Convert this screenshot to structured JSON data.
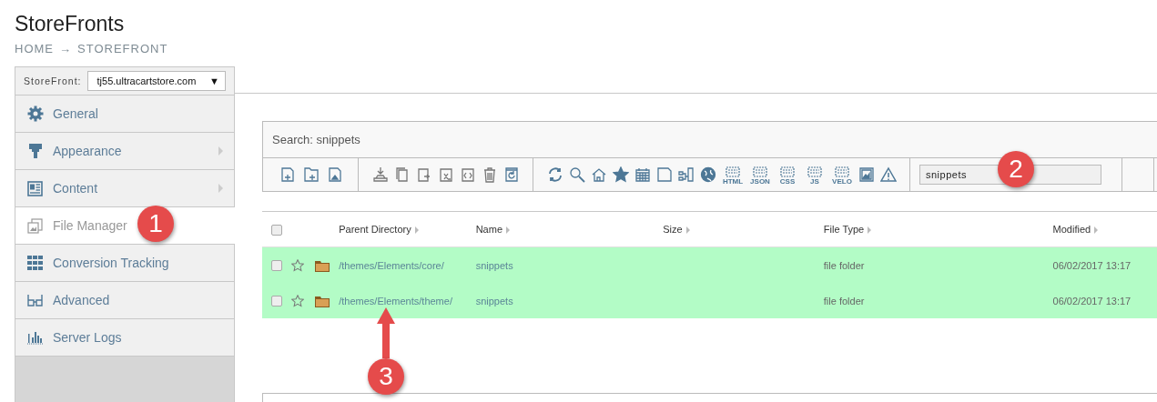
{
  "page": {
    "title": "StoreFronts",
    "breadcrumb": [
      {
        "label": "HOME"
      },
      {
        "label": "STOREFRONT"
      }
    ],
    "breadcrumb_separator": "→"
  },
  "storefront_selector": {
    "label": "StoreFront:",
    "value": "tj55.ultracartstore.com",
    "caret": "▼"
  },
  "sidebar": {
    "items": [
      {
        "label": "General",
        "selected": false,
        "submenu": false
      },
      {
        "label": "Appearance",
        "selected": false,
        "submenu": true
      },
      {
        "label": "Content",
        "selected": false,
        "submenu": true
      },
      {
        "label": "File Manager",
        "selected": true,
        "submenu": false
      },
      {
        "label": "Conversion Tracking",
        "selected": false,
        "submenu": false
      },
      {
        "label": "Advanced",
        "selected": false,
        "submenu": false
      },
      {
        "label": "Server Logs",
        "selected": false,
        "submenu": false
      }
    ]
  },
  "file_manager": {
    "heading": "Search: snippets",
    "toolbar": {
      "file_type_labels": [
        "HTML",
        "JSON",
        "CSS",
        "JS",
        "VELO"
      ],
      "search": {
        "value": "snippets"
      }
    },
    "table": {
      "select_all": {
        "checked": false
      },
      "columns": [
        "Parent Directory",
        "Name",
        "Size",
        "File Type",
        "Modified"
      ],
      "rows": [
        {
          "checked": false,
          "starred": false,
          "selected": true,
          "parent_directory": "/themes/Elements/core/",
          "name": "snippets",
          "file_type": "file folder",
          "modified": "06/02/2017 13:17"
        },
        {
          "checked": false,
          "starred": false,
          "selected": true,
          "parent_directory": "/themes/Elements/theme/",
          "name": "snippets",
          "file_type": "file folder",
          "modified": "06/02/2017 13:17"
        }
      ]
    }
  },
  "callouts": [
    {
      "text": "1"
    },
    {
      "text": "2"
    },
    {
      "text": "3"
    }
  ]
}
